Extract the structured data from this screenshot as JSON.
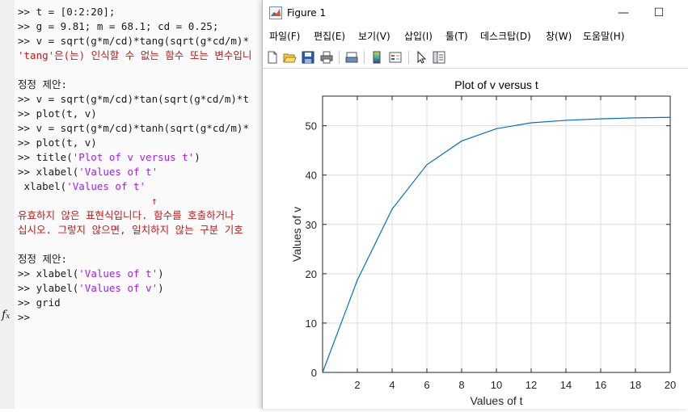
{
  "console": {
    "lines": [
      {
        "prompt": ">> ",
        "text": "t = [0:2:20];"
      },
      {
        "prompt": ">> ",
        "text": "g = 9.81; m = 68.1; cd = 0.25;"
      },
      {
        "prompt": ">> ",
        "text": "v = sqrt(g*m/cd)*tang(sqrt(g*cd/m)*"
      },
      {
        "error": "'tang'은(는) 인식할 수 없는 함수 또는 변수입니"
      },
      {
        "text": ""
      },
      {
        "plain": "정정 제안:"
      },
      {
        "prompt": ">> ",
        "text": "v = sqrt(g*m/cd)*tan(sqrt(g*cd/m)*t"
      },
      {
        "prompt": ">> ",
        "text": "plot(t, v)"
      },
      {
        "prompt": ">> ",
        "text": "v = sqrt(g*m/cd)*tanh(sqrt(g*cd/m)*"
      },
      {
        "prompt": ">> ",
        "text": "plot(t, v)"
      },
      {
        "prompt": ">> ",
        "text": "title(",
        "str": "'Plot of v versus t'",
        "after": ")"
      },
      {
        "prompt": ">> ",
        "text": "xlabel(",
        "str": "'Values of t'",
        "after": ""
      },
      {
        "indent": " ",
        "text": "xlabel(",
        "errstr": "'Values of t'"
      },
      {
        "caret": "↑"
      },
      {
        "error": "유효하지 않은 표현식입니다. 함수를 호출하거나"
      },
      {
        "error": "십시오. 그렇지 않으면, 일치하지 않는 구분 기호"
      },
      {
        "text": ""
      },
      {
        "plain": "정정 제안:"
      },
      {
        "prompt": ">> ",
        "text": "xlabel(",
        "str": "'Values of t'",
        "after": ")"
      },
      {
        "prompt": ">> ",
        "text": "ylabel(",
        "str": "'Values of v'",
        "after": ")"
      },
      {
        "prompt": ">> ",
        "text": "grid"
      },
      {
        "prompt": ">> ",
        "text": ""
      }
    ],
    "fx_icon": "fx-icon"
  },
  "figure": {
    "window_title": "Figure 1",
    "minimize": "—",
    "maximize": "☐",
    "menu": [
      "파일(F)",
      "편집(E)",
      "보기(V)",
      "삽입(I)",
      "툴(T)",
      "데스크탑(D)",
      "창(W)",
      "도움말(H)"
    ],
    "toolbar_icons": [
      "new-figure-icon",
      "open-file-icon",
      "save-icon",
      "print-icon",
      "print-preview-icon",
      "colorbar-icon",
      "legend-icon",
      "edit-plot-arrow-icon",
      "property-inspector-icon"
    ]
  },
  "colors": {
    "line": "#0072bd",
    "string": "#a020f0",
    "error": "#c01818"
  },
  "chart_data": {
    "type": "line",
    "title": "Plot of v versus t",
    "xlabel": "Values of t",
    "ylabel": "Values of v",
    "xlim": [
      0,
      20
    ],
    "ylim": [
      0,
      56
    ],
    "xticks": [
      2,
      4,
      6,
      8,
      10,
      12,
      14,
      16,
      18,
      20
    ],
    "yticks": [
      0,
      10,
      20,
      30,
      40,
      50
    ],
    "grid": true,
    "series": [
      {
        "x": [
          0,
          2,
          4,
          6,
          8,
          10,
          12,
          14,
          16,
          18,
          20
        ],
        "y": [
          0,
          18.7,
          33.1,
          42.1,
          46.9,
          49.4,
          50.6,
          51.1,
          51.4,
          51.6,
          51.7
        ]
      }
    ]
  }
}
